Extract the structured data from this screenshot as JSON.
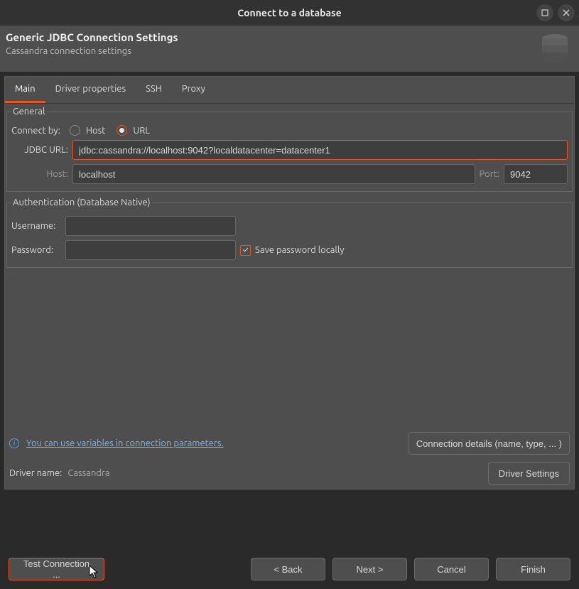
{
  "window": {
    "title": "Connect to a database"
  },
  "header": {
    "title": "Generic JDBC Connection Settings",
    "subtitle": "Cassandra connection settings"
  },
  "tabs": [
    "Main",
    "Driver properties",
    "SSH",
    "Proxy"
  ],
  "general": {
    "legend": "General",
    "connect_by_label": "Connect by:",
    "host_option": "Host",
    "url_option": "URL",
    "jdbc_url_label": "JDBC URL:",
    "jdbc_url_value": "jdbc:cassandra://localhost:9042?localdatacenter=datacenter1",
    "host_label": "Host:",
    "host_value": "localhost",
    "port_label": "Port:",
    "port_value": "9042"
  },
  "auth": {
    "legend": "Authentication (Database Native)",
    "username_label": "Username:",
    "username_value": "",
    "password_label": "Password:",
    "password_value": "",
    "save_password_label": "Save password locally"
  },
  "info_link": "You can use variables in connection parameters.",
  "conn_details_btn": "Connection details (name, type, ... )",
  "driver": {
    "label": "Driver name:",
    "name": "Cassandra",
    "settings_btn": "Driver Settings"
  },
  "footer": {
    "test": "Test Connection ...",
    "back": "< Back",
    "next": "Next >",
    "cancel": "Cancel",
    "finish": "Finish"
  }
}
